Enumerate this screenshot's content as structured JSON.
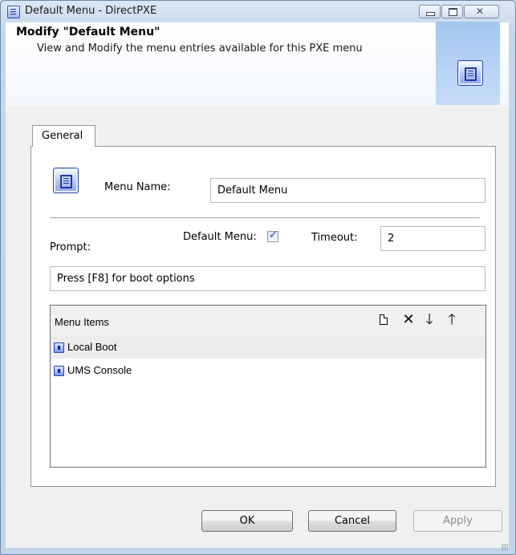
{
  "window": {
    "title": "Default Menu - DirectPXE",
    "controls": {
      "minimize": "minimize",
      "maximize": "maximize",
      "close": "✕"
    }
  },
  "header": {
    "title": "Modify \"Default Menu\"",
    "description": "View and Modify the menu entries available for this PXE menu"
  },
  "tabs": [
    {
      "label": "General",
      "selected": true
    }
  ],
  "general": {
    "menu_name_label": "Menu Name:",
    "menu_name_value": "Default Menu",
    "default_menu_label": "Default Menu:",
    "default_menu_checked": true,
    "timeout_label": "Timeout:",
    "timeout_value": "2",
    "prompt_label": "Prompt:",
    "prompt_value": "Press [F8] for boot options"
  },
  "menu_items": {
    "title": "Menu Items",
    "toolbar": [
      {
        "name": "new-item",
        "icon": "new-document-icon"
      },
      {
        "name": "delete-item",
        "icon": "delete-x-icon",
        "glyph": "✕"
      },
      {
        "name": "move-down",
        "icon": "arrow-down-icon",
        "glyph": "🡓"
      },
      {
        "name": "move-up",
        "icon": "arrow-up-icon",
        "glyph": "🡑"
      }
    ],
    "items": [
      {
        "label": "Local Boot",
        "selected": true
      },
      {
        "label": "UMS Console",
        "selected": false
      }
    ]
  },
  "buttons": {
    "ok": "OK",
    "cancel": "Cancel",
    "apply": "Apply",
    "apply_enabled": false
  }
}
